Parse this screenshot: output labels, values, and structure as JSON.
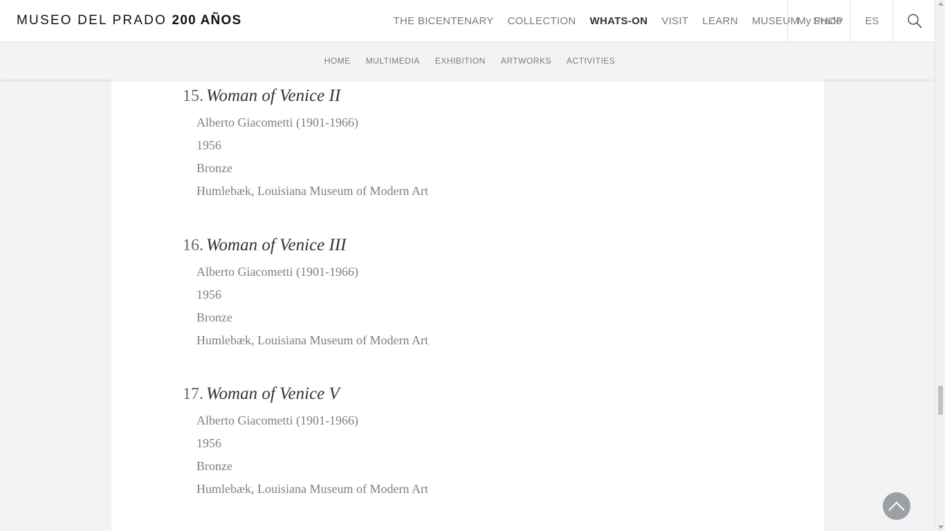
{
  "header": {
    "logo_text": "MUSEO DEL PRADO",
    "logo_bold": "200 AÑOS",
    "nav": [
      "THE BICENTENARY",
      "COLLECTION",
      "WHATS-ON",
      "VISIT",
      "LEARN",
      "MUSEUM",
      "SHOP"
    ],
    "active_nav": "WHATS-ON",
    "my_prado": "My Prado",
    "language": "ES"
  },
  "subnav": [
    "HOME",
    "MULTIMEDIA",
    "EXHIBITION",
    "ARTWORKS",
    "ACTIVITIES"
  ],
  "entries": [
    {
      "number": "15.",
      "title": "Woman of Venice II",
      "artist": "Alberto Giacometti (1901-1966)",
      "year": "1956",
      "medium": "Bronze",
      "location": "Humlebæk, Louisiana Museum of Modern Art"
    },
    {
      "number": "16.",
      "title": "Woman of Venice III",
      "artist": "Alberto Giacometti (1901-1966)",
      "year": "1956",
      "medium": "Bronze",
      "location": "Humlebæk, Louisiana Museum of Modern Art"
    },
    {
      "number": "17.",
      "title": "Woman of Venice V",
      "artist": "Alberto Giacometti (1901-1966)",
      "year": "1956",
      "medium": "Bronze",
      "location": "Humlebæk, Louisiana Museum of Modern Art"
    }
  ],
  "icons": {
    "search": "search-icon",
    "back_to_top": "chevron-up-icon"
  }
}
